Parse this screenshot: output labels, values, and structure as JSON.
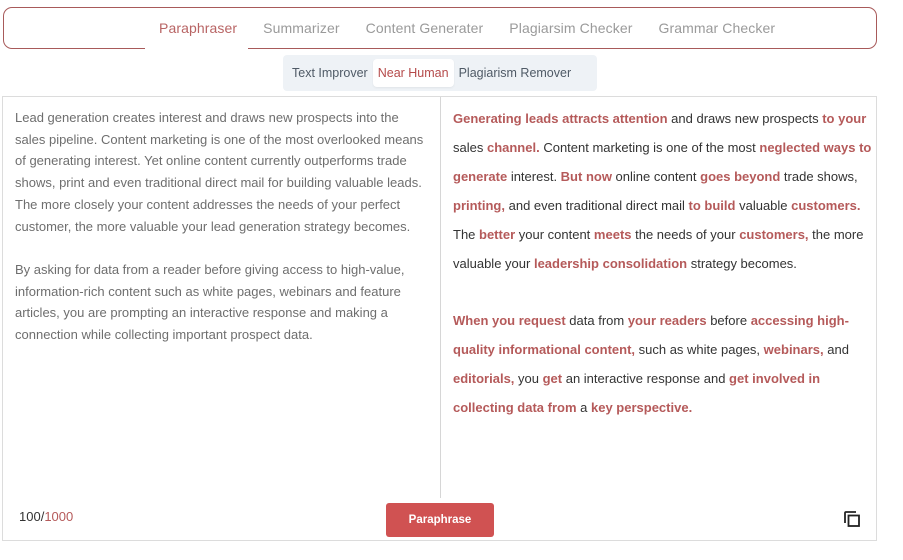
{
  "top_nav": {
    "tabs": [
      {
        "label": "Paraphraser",
        "active": true
      },
      {
        "label": "Summarizer",
        "active": false
      },
      {
        "label": "Content Generater",
        "active": false
      },
      {
        "label": "Plagiarsim Checker",
        "active": false
      },
      {
        "label": "Grammar Checker",
        "active": false
      }
    ]
  },
  "sub_tabs": [
    {
      "label": "Text Improver",
      "active": false
    },
    {
      "label": "Near Human",
      "active": true
    },
    {
      "label": "Plagiarism Remover",
      "active": false
    }
  ],
  "input": {
    "paragraphs": [
      "Lead generation creates interest and draws new prospects into the sales pipeline. Content marketing is one of the most overlooked means of generating interest. Yet online content currently outperforms trade shows, print and even traditional direct mail for building valuable leads. The more closely your content addresses the needs of your perfect customer, the more valuable your lead generation strategy becomes.",
      "By asking for data from a reader before giving access to high-value, information-rich content such as white pages, webinars and feature articles, you are prompting an interactive response and making a connection while collecting important prospect data."
    ]
  },
  "output": {
    "paragraphs": [
      [
        {
          "text": "Generating leads attracts attention",
          "changed": true
        },
        {
          "text": " and draws new prospects ",
          "changed": false
        },
        {
          "text": "to your",
          "changed": true
        },
        {
          "text": " sales ",
          "changed": false
        },
        {
          "text": "channel.",
          "changed": true
        },
        {
          "text": " Content marketing is one of the most ",
          "changed": false
        },
        {
          "text": "neglected ways to generate",
          "changed": true
        },
        {
          "text": " interest. ",
          "changed": false
        },
        {
          "text": "But now",
          "changed": true
        },
        {
          "text": " online content ",
          "changed": false
        },
        {
          "text": "goes beyond",
          "changed": true
        },
        {
          "text": " trade shows, ",
          "changed": false
        },
        {
          "text": "printing,",
          "changed": true
        },
        {
          "text": " and even traditional direct mail ",
          "changed": false
        },
        {
          "text": "to build",
          "changed": true
        },
        {
          "text": " valuable ",
          "changed": false
        },
        {
          "text": "customers.",
          "changed": true
        },
        {
          "text": " The ",
          "changed": false
        },
        {
          "text": "better",
          "changed": true
        },
        {
          "text": " your content ",
          "changed": false
        },
        {
          "text": "meets",
          "changed": true
        },
        {
          "text": " the needs of your ",
          "changed": false
        },
        {
          "text": "customers,",
          "changed": true
        },
        {
          "text": " the more valuable your ",
          "changed": false
        },
        {
          "text": "leadership consolidation",
          "changed": true
        },
        {
          "text": " strategy becomes.",
          "changed": false
        }
      ],
      [
        {
          "text": "When you request",
          "changed": true
        },
        {
          "text": " data from ",
          "changed": false
        },
        {
          "text": "your readers",
          "changed": true
        },
        {
          "text": " before ",
          "changed": false
        },
        {
          "text": "accessing high-quality informational content,",
          "changed": true
        },
        {
          "text": " such as white pages, ",
          "changed": false
        },
        {
          "text": "webinars,",
          "changed": true
        },
        {
          "text": " and ",
          "changed": false
        },
        {
          "text": "editorials,",
          "changed": true
        },
        {
          "text": " you ",
          "changed": false
        },
        {
          "text": "get",
          "changed": true
        },
        {
          "text": " an interactive response and ",
          "changed": false
        },
        {
          "text": "get involved in collecting data from",
          "changed": true
        },
        {
          "text": " a ",
          "changed": false
        },
        {
          "text": "key perspective.",
          "changed": true
        }
      ]
    ]
  },
  "footer": {
    "count": "100",
    "separator": "/",
    "max": "1000",
    "paraphrase_label": "Paraphrase",
    "copy_icon": "copy-icon"
  },
  "colors": {
    "accent": "#b55a5a",
    "button": "#d05252",
    "nav_border": "#a85a5a",
    "subtab_bg": "#eef2f6"
  }
}
